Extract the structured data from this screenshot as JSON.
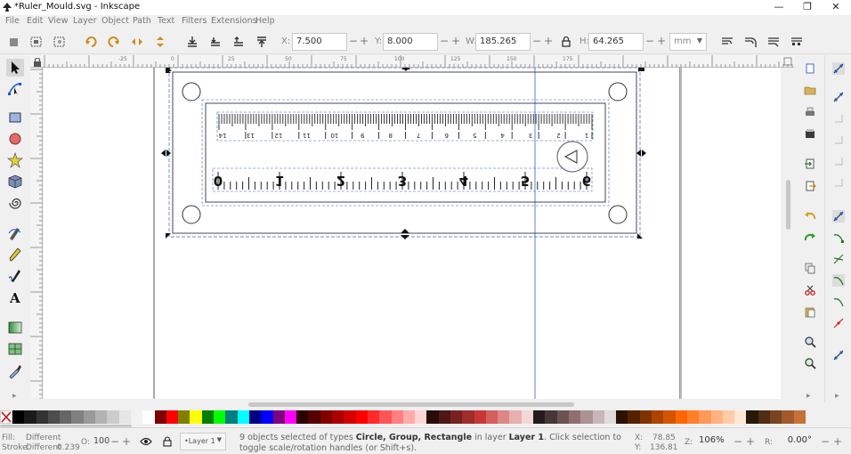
{
  "window": {
    "title": "*Ruler_Mould.svg - Inkscape",
    "minimize_glyph": "—",
    "maximize_glyph": "❐",
    "close_glyph": "✕"
  },
  "menu": [
    "File",
    "Edit",
    "View",
    "Layer",
    "Object",
    "Path",
    "Text",
    "Filters",
    "Extensions",
    "Help"
  ],
  "toolbar": {
    "x_label": "X:",
    "x_value": "7.500",
    "y_label": "Y:",
    "y_value": "8.000",
    "w_label": "W:",
    "w_value": "185.265",
    "h_label": "H:",
    "h_value": "64.265",
    "unit": "mm",
    "minus": "−",
    "plus": "+"
  },
  "ruler": {
    "h_ticks": [
      "-25",
      "0",
      "25",
      "50",
      "75",
      "100",
      "125",
      "150",
      "175"
    ],
    "v_ticks": [
      "0",
      "25",
      "50",
      "75",
      "100"
    ]
  },
  "ruler_art": {
    "top_labels": [
      "14",
      "13",
      "12",
      "11",
      "10",
      "9",
      "8",
      "7",
      "6",
      "5",
      "4",
      "3",
      "2",
      "1"
    ],
    "bottom_labels": [
      "0",
      "1",
      "2",
      "3",
      "4",
      "5",
      "6"
    ]
  },
  "palette": [
    "#000000",
    "#1a1a1a",
    "#333333",
    "#4d4d4d",
    "#666666",
    "#808080",
    "#999999",
    "#b3b3b3",
    "#cccccc",
    "#e6e6e6",
    "#f2f2f2",
    "#ffffff",
    "#800000",
    "#ff0000",
    "#808000",
    "#ffff00",
    "#008000",
    "#00ff00",
    "#008080",
    "#00ffff",
    "#000080",
    "#0000ff",
    "#800080",
    "#ff00ff",
    "#2b0000",
    "#550000",
    "#800000",
    "#aa0000",
    "#d40000",
    "#ff0000",
    "#ff2a2a",
    "#ff5555",
    "#ff8080",
    "#ffaaaa",
    "#ffd5d5",
    "#280b0b",
    "#501616",
    "#782121",
    "#a02c2c",
    "#c83737",
    "#d35f5f",
    "#de8787",
    "#e9afaf",
    "#f4d7d7",
    "#241c1c",
    "#483737",
    "#6c5353",
    "#916f6f",
    "#ac9393",
    "#c8b7b7",
    "#e3dbdb",
    "#2b1100",
    "#552200",
    "#803300",
    "#aa4400",
    "#d45500",
    "#ff6600",
    "#ff7f2a",
    "#ff9955",
    "#ffb380",
    "#ffccaa",
    "#ffe6d5",
    "#28170b",
    "#502d16",
    "#784421",
    "#a05a2c",
    "#c87137"
  ],
  "status": {
    "fill_label": "Fill:",
    "fill_value": "Different",
    "stroke_label": "Stroke:",
    "stroke_value": "Different",
    "stroke_width": "0.239",
    "opacity_label": "O:",
    "opacity_value": "100",
    "layer": "•Layer 1",
    "message_prefix": "9 objects selected of types ",
    "message_types": "Circle, Group, Rectangle",
    "message_mid": " in layer ",
    "message_layer": "Layer 1",
    "message_suffix": ". Click selection to toggle scale/rotation handles (or Shift+s).",
    "cx_label": "X:",
    "cx_value": "78.85",
    "cy_label": "Y:",
    "cy_value": "136.81",
    "zoom_label": "Z:",
    "zoom_value": "106%",
    "rot_label": "R:",
    "rot_value": "0.00°"
  }
}
